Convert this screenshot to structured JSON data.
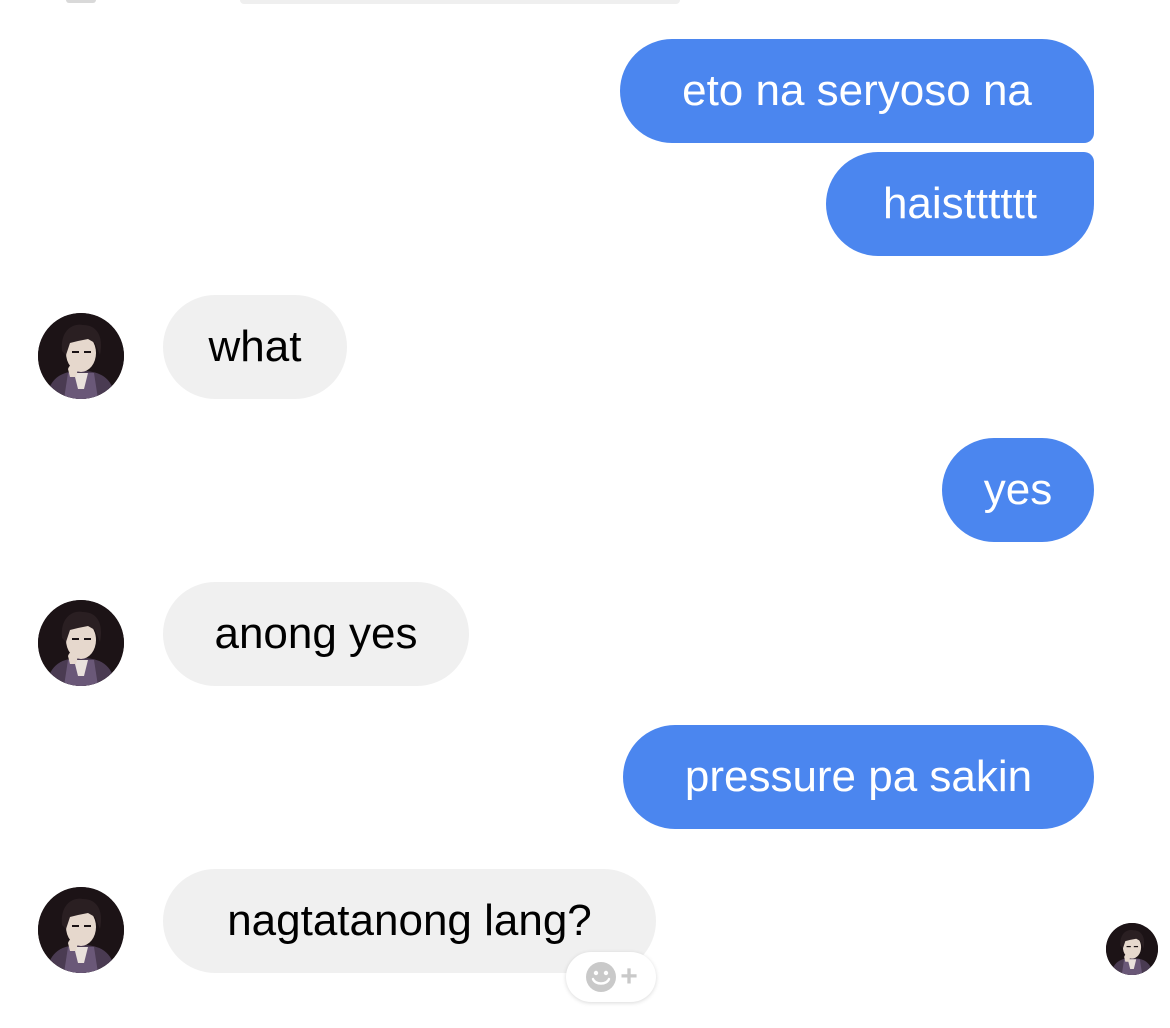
{
  "conversation": {
    "messages": [
      {
        "direction": "outgoing",
        "text": "eto na seryoso na"
      },
      {
        "direction": "outgoing",
        "text": "haistttttt"
      },
      {
        "direction": "incoming",
        "text": "what"
      },
      {
        "direction": "outgoing",
        "text": "yes"
      },
      {
        "direction": "incoming",
        "text": "anong yes"
      },
      {
        "direction": "outgoing",
        "text": "pressure pa sakin"
      },
      {
        "direction": "incoming",
        "text": "nagtatanong lang?"
      }
    ],
    "reaction_button": {
      "icons": [
        "smiley-icon",
        "plus-icon"
      ],
      "plus_glyph": "+"
    },
    "read_receipt": {
      "icon": "avatar"
    }
  },
  "colors": {
    "outgoing_bubble": "#4b86ef",
    "incoming_bubble": "#f0f0f0",
    "outgoing_text": "#ffffff",
    "incoming_text": "#000000"
  }
}
